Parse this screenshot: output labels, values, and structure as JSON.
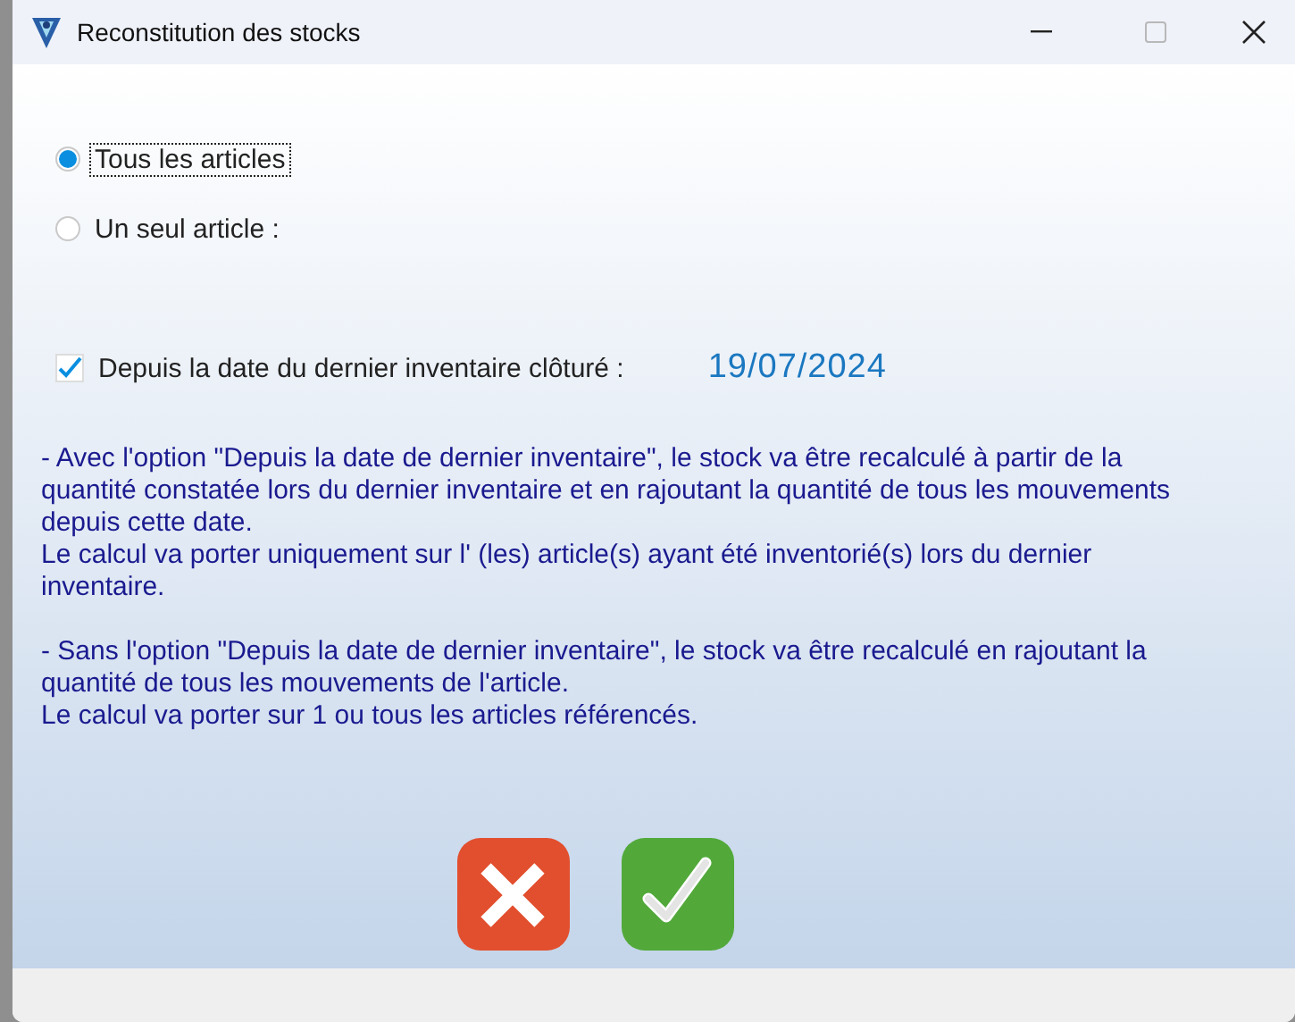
{
  "window": {
    "title": "Reconstitution des stocks",
    "maximize_disabled": true
  },
  "scope_options": [
    {
      "label": "Tous les articles",
      "selected": true,
      "focused": true
    },
    {
      "label": "Un seul article :",
      "selected": false,
      "focused": false
    }
  ],
  "since_inventory": {
    "label": "Depuis la date du dernier inventaire clôturé :",
    "checked": true,
    "date": "19/07/2024"
  },
  "explanation": [
    {
      "paragraphs": [
        "- Avec l'option \"Depuis la date de dernier inventaire\", le stock va être recalculé à partir de la quantité constatée lors du dernier inventaire et en rajoutant la quantité de tous les mouvements depuis cette date.",
        "Le calcul va porter uniquement sur l' (les) article(s) ayant été inventorié(s) lors du dernier inventaire."
      ]
    },
    {
      "paragraphs": [
        "- Sans l'option \"Depuis la date de dernier inventaire\", le stock va être recalculé en rajoutant la quantité de tous les mouvements de l'article.",
        "Le calcul va porter sur 1 ou tous les articles référencés."
      ]
    }
  ],
  "buttons": [
    {
      "kind": "cancel"
    },
    {
      "kind": "ok"
    }
  ]
}
